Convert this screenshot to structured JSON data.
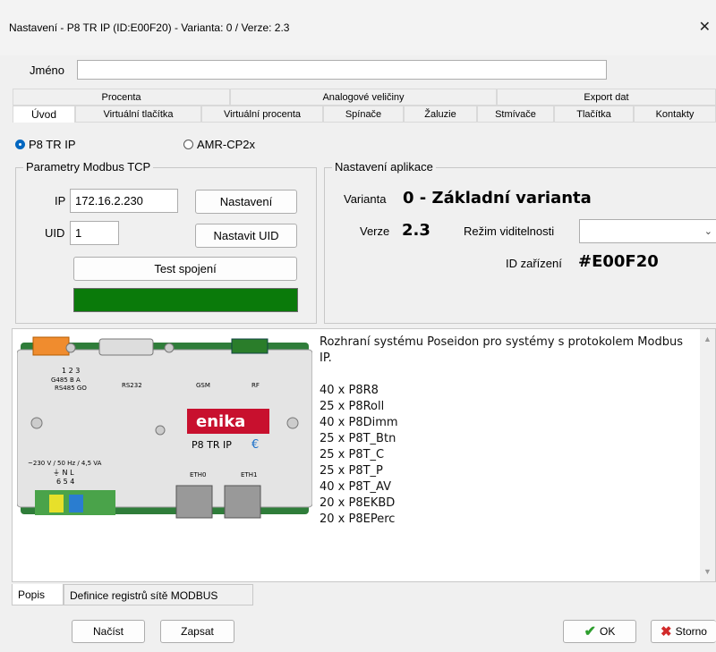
{
  "window": {
    "title": "Nastavení - P8 TR IP (ID:E00F20) - Varianta: 0 / Verze: 2.3",
    "close_glyph": "✕"
  },
  "name_label": "Jméno",
  "name_value": "",
  "tabs_row1": [
    "Procenta",
    "Analogové veličiny",
    "Export dat"
  ],
  "tabs_row2": [
    "Úvod",
    "Virtuální tlačítka",
    "Virtuální procenta",
    "Spínače",
    "Žaluzie",
    "Stmívače",
    "Tlačítka",
    "Kontakty"
  ],
  "device_choice": {
    "option1": "P8 TR IP",
    "option2": "AMR-CP2x",
    "selected": "P8 TR IP"
  },
  "modbus": {
    "group_title": "Parametry Modbus TCP",
    "ip_label": "IP",
    "ip_value": "172.16.2.230",
    "settings_button": "Nastavení",
    "uid_label": "UID",
    "uid_value": "1",
    "set_uid_button": "Nastavit UID",
    "test_button": "Test spojení",
    "status_color": "#0a7a0a"
  },
  "app_settings": {
    "group_title": "Nastavení aplikace",
    "variant_label": "Varianta",
    "variant_value": "0 - Základní varianta",
    "version_label": "Verze",
    "version_value": "2.3",
    "visibility_label": "Režim viditelnosti",
    "visibility_value": "",
    "device_id_label": "ID zařízení",
    "device_id_value": "#E00F20"
  },
  "device_image": {
    "brand": "enika",
    "model": "P8 TR IP",
    "ports": [
      "RS232",
      "GSM",
      "RF",
      "ETH0",
      "ETH1"
    ],
    "pins_top": "1  2  3",
    "pins_top_label": "G485  B  A",
    "pins_top_label2": "RS485 GO",
    "power_label": "~230 V / 50 Hz / 4,5 VA",
    "pins_bottom_label": "⏚  N  L",
    "pins_bottom": "6  5  4"
  },
  "description": "Rozhraní systému Poseidon pro systémy s protokolem Modbus IP.\n\n40 x P8R8\n25 x P8Roll\n40 x P8Dimm\n25 x P8T_Btn\n25 x P8T_C\n25 x P8T_P\n40 x P8T_AV\n20 x P8EKBD\n20 x P8EPerc",
  "bottom_tabs": [
    "Popis",
    "Definice registrů sítě MODBUS"
  ],
  "footer": {
    "load_button": "Načíst",
    "write_button": "Zapsat",
    "ok_button": "OK",
    "cancel_button": "Storno"
  }
}
